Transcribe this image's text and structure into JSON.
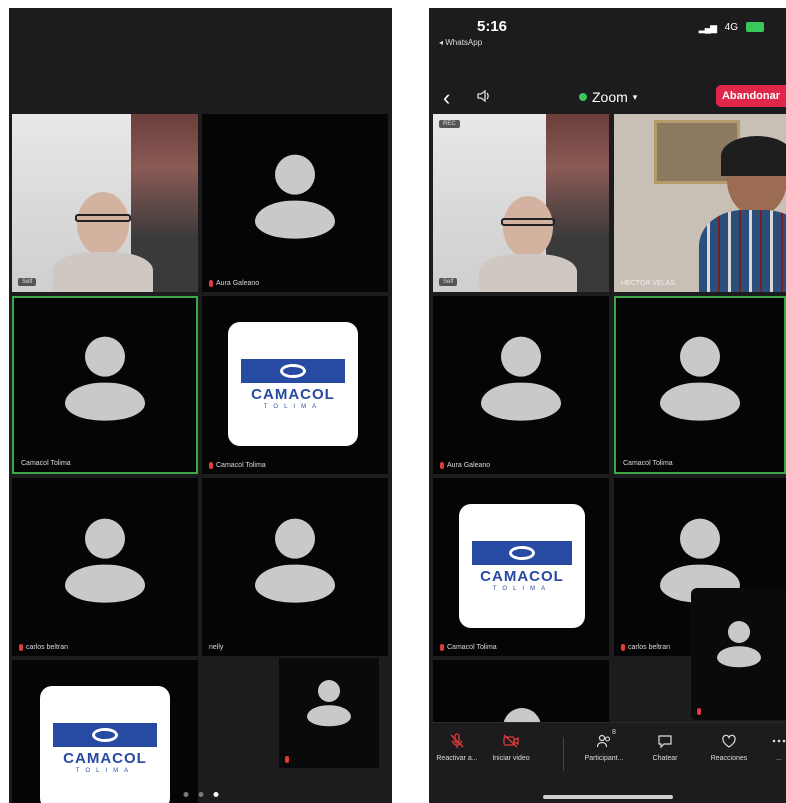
{
  "left": {
    "tiles": [
      {
        "name": "",
        "badge": "Self"
      },
      {
        "name": "Aura Galeano"
      },
      {
        "name": "Camacol Tolima"
      },
      {
        "name": "Camacol Tolima"
      },
      {
        "name": "carlos beltran"
      },
      {
        "name": "nelly"
      },
      {
        "name": ""
      },
      {
        "name": ""
      }
    ],
    "logo": {
      "text": "CAMACOL",
      "sub": "TOLIMA"
    },
    "pages": 3,
    "active_page": 3
  },
  "right": {
    "status": {
      "time": "5:16",
      "back_app": "◂ WhatsApp",
      "network": "4G"
    },
    "topbar": {
      "title": "Zoom",
      "leave_label": "Abandonar"
    },
    "tiles": [
      {
        "name": "",
        "badge": "Self",
        "tag": "REC"
      },
      {
        "name": "HECTOR VELAS"
      },
      {
        "name": "Aura Galeano"
      },
      {
        "name": "Camacol Tolima"
      },
      {
        "name": "Camacol Tolima"
      },
      {
        "name": "carlos beltran"
      }
    ],
    "toolbar": [
      {
        "label": "Reactivar a...",
        "icon": "mic-off-icon"
      },
      {
        "label": "Iniciar video",
        "icon": "video-off-icon"
      },
      {
        "label": "Participant...",
        "icon": "participants-icon",
        "count": "8"
      },
      {
        "label": "Chatear",
        "icon": "chat-icon"
      },
      {
        "label": "Reacciones",
        "icon": "heart-icon"
      },
      {
        "label": "...",
        "icon": "more-icon"
      }
    ],
    "logo": {
      "text": "CAMACOL",
      "sub": "TOLIMA"
    }
  },
  "colors": {
    "active_border": "#3aa845",
    "leave": "#e0274a",
    "logo_blue": "#274aa3",
    "background": "#1c1c1e"
  }
}
